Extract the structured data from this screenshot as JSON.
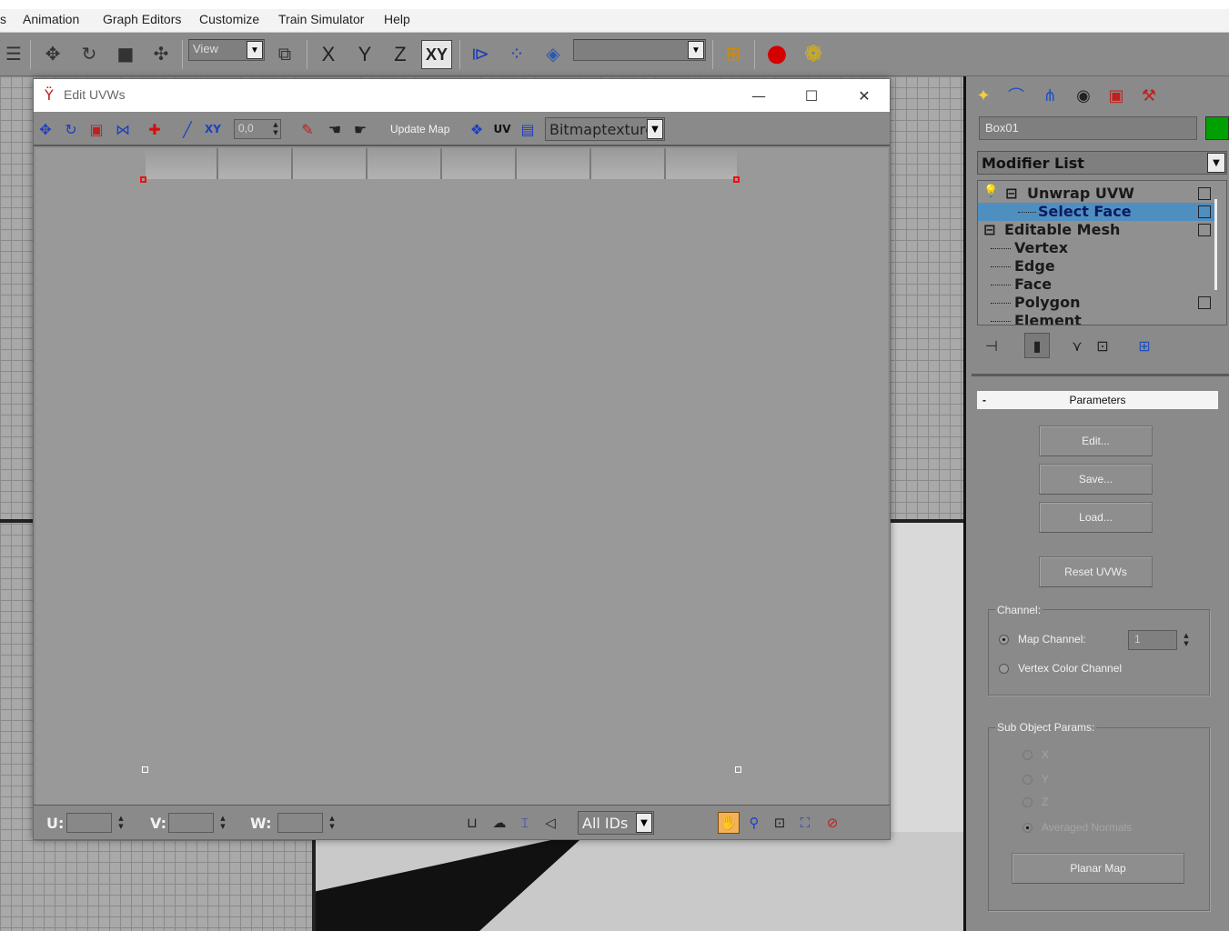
{
  "menu": {
    "items": [
      "s",
      "Animation",
      "Graph Editors",
      "Customize",
      "Train Simulator",
      "Help"
    ]
  },
  "toolbar": {
    "view_combo": "View",
    "axis_buttons": [
      "X",
      "Y",
      "Z",
      "XY"
    ],
    "active_axis": "XY",
    "selection_set_combo": ""
  },
  "command_panel": {
    "object_name": "Box01",
    "object_color": "#00a000",
    "modifier_list_label": "Modifier List",
    "stack": [
      {
        "label": "Unwrap UVW",
        "level": 0,
        "selected": false
      },
      {
        "label": "Select Face",
        "level": 1,
        "selected": true
      },
      {
        "label": "Editable Mesh",
        "level": 0,
        "selected": false
      },
      {
        "label": "Vertex",
        "level": 1,
        "selected": false
      },
      {
        "label": "Edge",
        "level": 1,
        "selected": false
      },
      {
        "label": "Face",
        "level": 1,
        "selected": false
      },
      {
        "label": "Polygon",
        "level": 1,
        "selected": false
      },
      {
        "label": "Element",
        "level": 1,
        "selected": false
      }
    ],
    "rollout_title": "Parameters",
    "rollout_toggle": "-",
    "buttons": {
      "edit": "Edit...",
      "save": "Save...",
      "load": "Load...",
      "reset": "Reset UVWs",
      "planar": "Planar Map"
    },
    "channel": {
      "group_label": "Channel:",
      "map_channel_label": "Map Channel:",
      "map_channel_value": "1",
      "vertex_color_label": "Vertex Color Channel",
      "selected": "map"
    },
    "sub_object": {
      "group_label": "Sub Object Params:",
      "options": [
        "X",
        "Y",
        "Z",
        "Averaged Normals"
      ],
      "selected": "Averaged Normals",
      "enabled": false
    }
  },
  "uvw_window": {
    "title": "Edit UVWs",
    "controls": {
      "minimize": "—",
      "maximize": "☐",
      "close": "✕"
    },
    "toolbar": {
      "spinner_value": "0,0",
      "update_map_label": "Update Map",
      "uv_label": "UV",
      "texture_combo": "Bitmaptexture"
    },
    "status": {
      "u_label": "U:",
      "v_label": "V:",
      "w_label": "W:",
      "u_value": "",
      "v_value": "",
      "w_value": "",
      "ids_combo": "All IDs",
      "active_tool": "pan"
    }
  }
}
